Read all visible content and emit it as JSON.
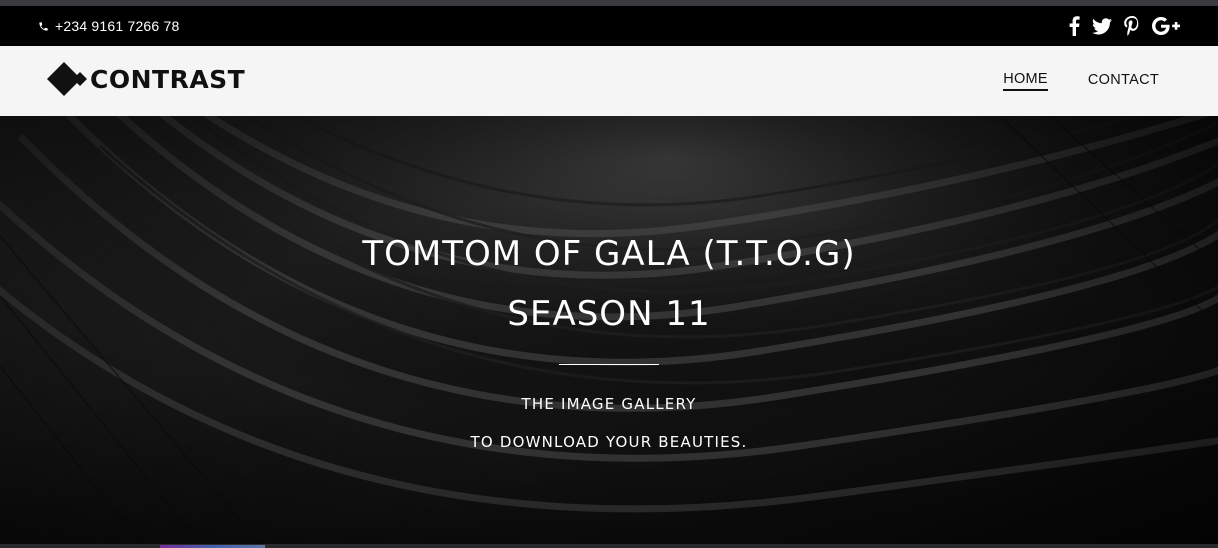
{
  "topbar": {
    "phone_icon": "phone-icon",
    "phone": "+234 9161 7266 78",
    "social": [
      "facebook-icon",
      "twitter-icon",
      "pinterest-icon",
      "google-plus-icon"
    ]
  },
  "navbar": {
    "logo_text": "CONTRAST",
    "items": [
      {
        "label": "HOME",
        "active": true
      },
      {
        "label": "CONTACT",
        "active": false
      }
    ]
  },
  "hero": {
    "title_line1": "TOMTOM OF GALA (T.T.O.G)",
    "title_line2": "SEASON 11",
    "subtitle_line1": "THE IMAGE GALLERY",
    "subtitle_line2": "TO DOWNLOAD YOUR BEAUTIES."
  },
  "colors": {
    "topbar_bg": "#000000",
    "navbar_bg": "#f5f5f5",
    "text_dark": "#111111",
    "hero_text": "#ffffff"
  }
}
